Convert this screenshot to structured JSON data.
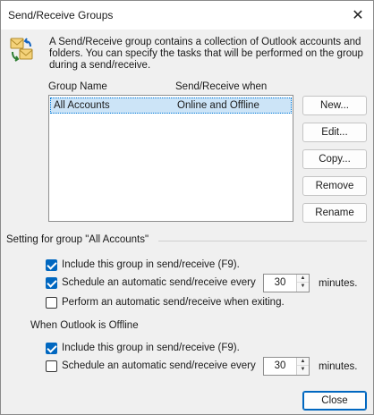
{
  "window": {
    "title": "Send/Receive Groups",
    "close_glyph": "✕"
  },
  "description": "A Send/Receive group contains a collection of Outlook accounts and folders. You can specify the tasks that will be performed on the group during a send/receive.",
  "list": {
    "col_group_name": "Group Name",
    "col_when": "Send/Receive when",
    "rows": [
      {
        "name": "All Accounts",
        "when": "Online and Offline",
        "selected": true
      }
    ]
  },
  "buttons": {
    "new": "New...",
    "edit": "Edit...",
    "copy": "Copy...",
    "remove": "Remove",
    "rename": "Rename",
    "close": "Close"
  },
  "group_setting_label": "Setting for group \"All Accounts\"",
  "online": {
    "include": {
      "label": "Include this group in send/receive (F9).",
      "checked": true
    },
    "schedule": {
      "label": "Schedule an automatic send/receive every",
      "checked": true,
      "value": "30",
      "unit": "minutes."
    },
    "on_exit": {
      "label": "Perform an automatic send/receive when exiting.",
      "checked": false
    }
  },
  "offline_label": "When Outlook is Offline",
  "offline": {
    "include": {
      "label": "Include this group in send/receive (F9).",
      "checked": true
    },
    "schedule": {
      "label": "Schedule an automatic send/receive every",
      "checked": false,
      "value": "30",
      "unit": "minutes."
    }
  },
  "icons": {
    "info": "send-receive-groups-icon",
    "spin_up": "▲",
    "spin_down": "▼"
  }
}
